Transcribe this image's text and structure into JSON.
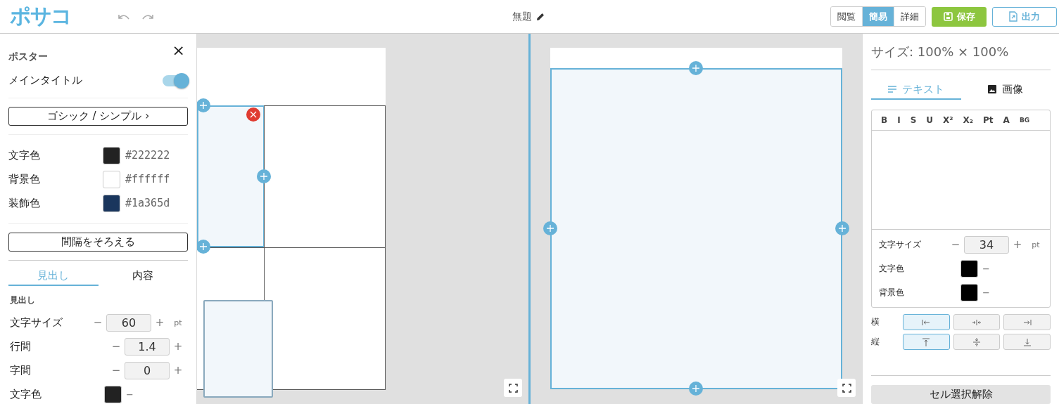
{
  "header": {
    "logo": "ポサコ",
    "title": "無題",
    "modes": [
      {
        "label": "閲覧",
        "selected": false
      },
      {
        "label": "簡易",
        "selected": true
      },
      {
        "label": "詳細",
        "selected": false
      }
    ],
    "save_label": "保存",
    "export_label": "出力"
  },
  "sidebar": {
    "title": "ポスター",
    "close": "×",
    "main_title": {
      "label": "メインタイトル",
      "on": true
    },
    "font_button": "ゴシック / シンプル ›",
    "colors": [
      {
        "label": "文字色",
        "color": "#222222",
        "value": "#222222"
      },
      {
        "label": "背景色",
        "color": "#ffffff",
        "value": "#ffffff"
      },
      {
        "label": "装飾色",
        "color": "#1a365d",
        "value": "#1a365d"
      }
    ],
    "spacing_button": "間隔をそろえる",
    "tabs": [
      {
        "label": "見出し",
        "selected": true
      },
      {
        "label": "内容",
        "selected": false
      }
    ],
    "section": "見出し",
    "rows": [
      {
        "kind": "stepper",
        "label": "文字サイズ",
        "dec": "−",
        "value": "60",
        "inc": "+",
        "unit": "pt"
      },
      {
        "kind": "stepper",
        "label": "行間",
        "dec": "−",
        "value": "1.4",
        "inc": "+"
      },
      {
        "kind": "stepper",
        "label": "字間",
        "dec": "−",
        "value": "0",
        "inc": "+"
      },
      {
        "kind": "color",
        "label": "文字色",
        "color": "#222222",
        "dash": "−"
      }
    ]
  },
  "canvases": [
    {
      "kind": "grid",
      "cells": [
        {
          "selected": true
        },
        {
          "selected": false
        },
        {
          "selected": false
        },
        {
          "selected": false
        }
      ]
    },
    {
      "kind": "single",
      "cells": [
        {
          "selected": true
        }
      ]
    }
  ],
  "right_panel": {
    "size": "サイズ: 100% × 100%",
    "tabs": [
      {
        "kind": "text",
        "label": "テキスト",
        "selected": true
      },
      {
        "kind": "image",
        "label": "画像",
        "selected": false
      }
    ],
    "format_tools": [
      "B",
      "I",
      "S",
      "U",
      "X²",
      "X₂",
      "Pt",
      "A",
      "BG"
    ],
    "rows": [
      {
        "kind": "stepper",
        "label": "文字サイズ",
        "dec": "−",
        "value": "34",
        "inc": "+",
        "unit": "pt"
      },
      {
        "kind": "color",
        "label": "文字色",
        "color": "#000000",
        "dash": "−"
      },
      {
        "kind": "color",
        "label": "背景色",
        "color": "#000000",
        "dash": "−"
      }
    ],
    "align": [
      {
        "label": "横",
        "options": [
          {
            "kind": "left",
            "selected": true
          },
          {
            "kind": "center",
            "selected": false
          },
          {
            "kind": "right",
            "selected": false
          }
        ]
      },
      {
        "label": "縦",
        "options": [
          {
            "kind": "top",
            "selected": true
          },
          {
            "kind": "middle",
            "selected": false
          },
          {
            "kind": "bottom",
            "selected": false
          }
        ]
      }
    ],
    "clear_button": "セル選択解除"
  }
}
